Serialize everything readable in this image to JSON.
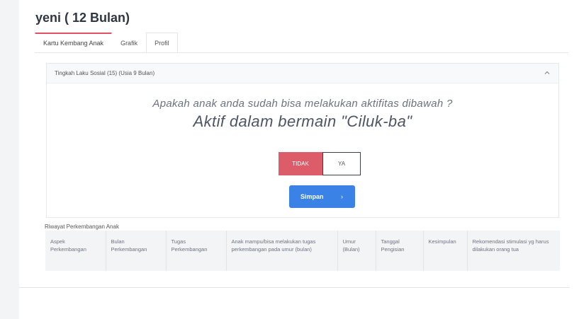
{
  "page": {
    "title": "yeni ( 12 Bulan)"
  },
  "tabs": [
    {
      "label": "Kartu Kembang Anak"
    },
    {
      "label": "Grafik"
    },
    {
      "label": "Profil"
    }
  ],
  "accordion": {
    "title": "Tingkah Laku Sosial (15) (Usia 9 Bulan)",
    "question": "Apakah anak anda sudah bisa melakukan aktifitas dibawah ?",
    "activity": "Aktif dalam bermain \"Ciluk-ba\"",
    "buttons": {
      "no": "TIDAK",
      "yes": "YA",
      "save": "Simpan",
      "save_arrow": "›"
    }
  },
  "history": {
    "label": "Riwayat Perkembangan Anak",
    "columns": [
      "Aspek Perkembangan",
      "Bulan Perkembangan",
      "Tugas Perkembangan",
      "Anak mampu/bisa melakukan tugas perkembangan pada umur (bulan)",
      "Umur (Bulan)",
      "Tanggal Pengisian",
      "Kesimpulan",
      "Rekomendasi stimulasi yg harus dilakukan orang tua"
    ]
  }
}
